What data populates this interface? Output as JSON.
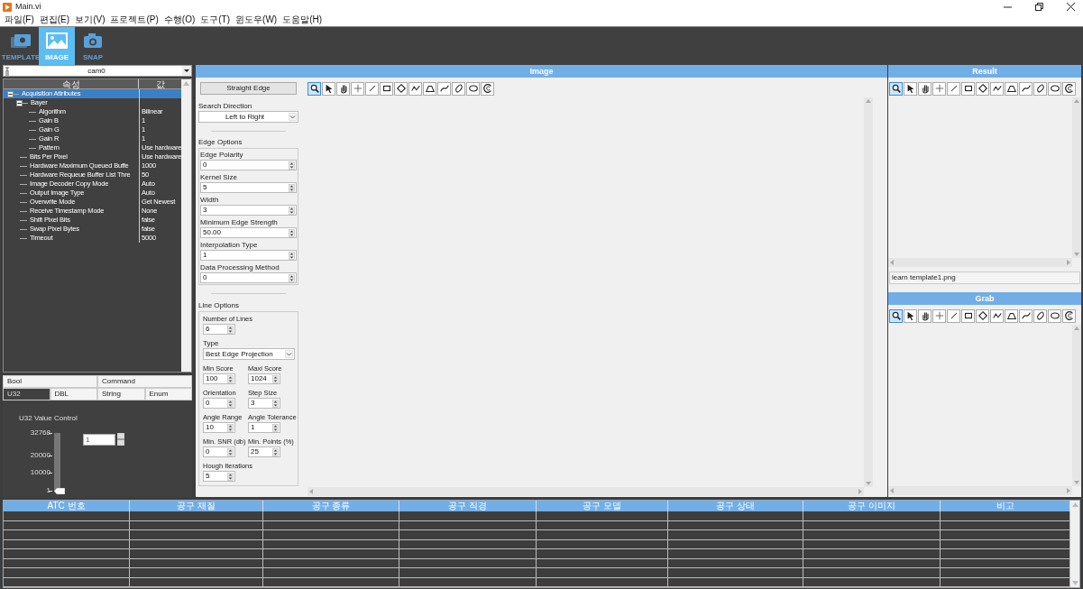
{
  "window": {
    "title": "Main.vi"
  },
  "menu": [
    "파일(F)",
    "편집(E)",
    "보기(V)",
    "프로젝트(P)",
    "수행(O)",
    "도구(T)",
    "윈도우(W)",
    "도움말(H)"
  ],
  "toolbar": [
    {
      "label": "TEMPLATE",
      "selected": false
    },
    {
      "label": "IMAGE",
      "selected": true
    },
    {
      "label": "SNAP",
      "selected": false
    }
  ],
  "camera_select": {
    "value": "cam0"
  },
  "property_tree": {
    "columns": [
      "속성",
      "값"
    ],
    "items": [
      {
        "label": "Acquisition Attributes",
        "selected": true,
        "expanded": true,
        "children": [
          {
            "label": "Bayer",
            "selected": false,
            "expanded": true,
            "children": [
              {
                "label": "Algorithm",
                "value": "Bilinear",
                "selected": false
              },
              {
                "label": "Gain B",
                "value": "1",
                "selected": false
              },
              {
                "label": "Gain G",
                "value": "1",
                "selected": false
              },
              {
                "label": "Gain R",
                "value": "1",
                "selected": false
              },
              {
                "label": "Pattern",
                "value": "Use hardware",
                "selected": false
              }
            ]
          },
          {
            "label": "Bits Per Pixel",
            "value": "Use hardware",
            "selected": false
          },
          {
            "label": "Hardware Maximum Queued Buffe",
            "value": "1000",
            "selected": false
          },
          {
            "label": "Hardware Requeue Buffer List Thre",
            "value": "50",
            "selected": false
          },
          {
            "label": "Image Decoder Copy Mode",
            "value": "Auto",
            "selected": false
          },
          {
            "label": "Output Image Type",
            "value": "Auto",
            "selected": false
          },
          {
            "label": "Overwrite Mode",
            "value": "Get Newest",
            "selected": false
          },
          {
            "label": "Receive Timestamp Mode",
            "value": "None",
            "selected": false
          },
          {
            "label": "Shift Pixel Bits",
            "value": "false",
            "selected": false
          },
          {
            "label": "Swap Pixel Bytes",
            "value": "false",
            "selected": false
          },
          {
            "label": "Timeout",
            "value": "5000",
            "selected": false
          }
        ]
      }
    ]
  },
  "type_tabs": [
    [
      {
        "label": "Bool",
        "selected": false
      },
      {
        "label": "Command",
        "selected": false
      }
    ],
    [
      {
        "label": "U32",
        "selected": true
      },
      {
        "label": "DBL",
        "selected": false
      },
      {
        "label": "String",
        "selected": false
      },
      {
        "label": "Enum",
        "selected": false
      }
    ]
  ],
  "u32_control": {
    "title": "U32 Value Control",
    "ticks": [
      "32768",
      "20000",
      "10000",
      "1"
    ],
    "level": 0,
    "value": "1"
  },
  "image_panel": {
    "title": "Image",
    "tool_button": "Straight Edge",
    "search_direction": {
      "label": "Search Direction",
      "value": "Left to Right"
    },
    "edge_options": {
      "title": "Edge Options",
      "fields": [
        {
          "label": "Edge Polarity",
          "value": "0"
        },
        {
          "label": "Kernel Size",
          "value": "5"
        },
        {
          "label": "Width",
          "value": "3"
        },
        {
          "label": "Minimum Edge Strength",
          "value": "50.00"
        },
        {
          "label": "Interpolation Type",
          "value": "1"
        },
        {
          "label": "Data Processing Method",
          "value": "0"
        }
      ]
    },
    "line_options": {
      "title": "Line Options",
      "rows": [
        [
          {
            "kind": "spin",
            "label": "Number of Lines",
            "value": "6"
          }
        ],
        [
          {
            "kind": "dropdown",
            "label": "Type",
            "value": "Best Edge Projection"
          }
        ],
        [
          {
            "kind": "spin",
            "label": "Min Score",
            "value": "100"
          },
          {
            "kind": "spin",
            "label": "Maxi Score",
            "value": "1024"
          }
        ],
        [
          {
            "kind": "spin",
            "label": "Orientation",
            "value": "0"
          },
          {
            "kind": "spin",
            "label": "Step Size",
            "value": "3"
          }
        ],
        [
          {
            "kind": "spin",
            "label": "Angle Range",
            "value": "10"
          },
          {
            "kind": "spin",
            "label": "Angle Tolerance",
            "value": "1"
          }
        ],
        [
          {
            "kind": "spin",
            "label": "Min. SNR (db)",
            "value": "0"
          },
          {
            "kind": "spin",
            "label": "Min. Points (%)",
            "value": "25"
          }
        ],
        [
          {
            "kind": "spin",
            "label": "Hough Iterations",
            "value": "5"
          }
        ]
      ]
    },
    "tools": [
      {
        "selected": true
      },
      {
        "selected": false
      },
      {
        "selected": false
      },
      {
        "selected": false
      },
      {
        "selected": false
      },
      {
        "selected": false
      },
      {
        "selected": false
      },
      {
        "selected": false
      },
      {
        "selected": false
      },
      {
        "selected": false
      },
      {
        "selected": false
      },
      {
        "selected": false
      },
      {
        "selected": false
      }
    ]
  },
  "result_panel": {
    "title": "Result",
    "tools": [
      {
        "selected": true
      },
      {
        "selected": false
      },
      {
        "selected": false
      },
      {
        "selected": false
      },
      {
        "selected": false
      },
      {
        "selected": false
      },
      {
        "selected": false
      },
      {
        "selected": false
      },
      {
        "selected": false
      },
      {
        "selected": false
      },
      {
        "selected": false
      },
      {
        "selected": false
      },
      {
        "selected": false
      }
    ],
    "file_label": "learn template1.png"
  },
  "grab_panel": {
    "title": "Grab",
    "tools": [
      {
        "selected": true
      },
      {
        "selected": false
      },
      {
        "selected": false
      },
      {
        "selected": false
      },
      {
        "selected": false
      },
      {
        "selected": false
      },
      {
        "selected": false
      },
      {
        "selected": false
      },
      {
        "selected": false
      },
      {
        "selected": false
      },
      {
        "selected": false
      },
      {
        "selected": false
      },
      {
        "selected": false
      }
    ]
  },
  "tool_table": {
    "columns": [
      "ATC 번호",
      "공구 재질",
      "공구 종류",
      "공구 직경",
      "공구 모델",
      "공구 상태",
      "공구 이미지",
      "비고"
    ]
  }
}
